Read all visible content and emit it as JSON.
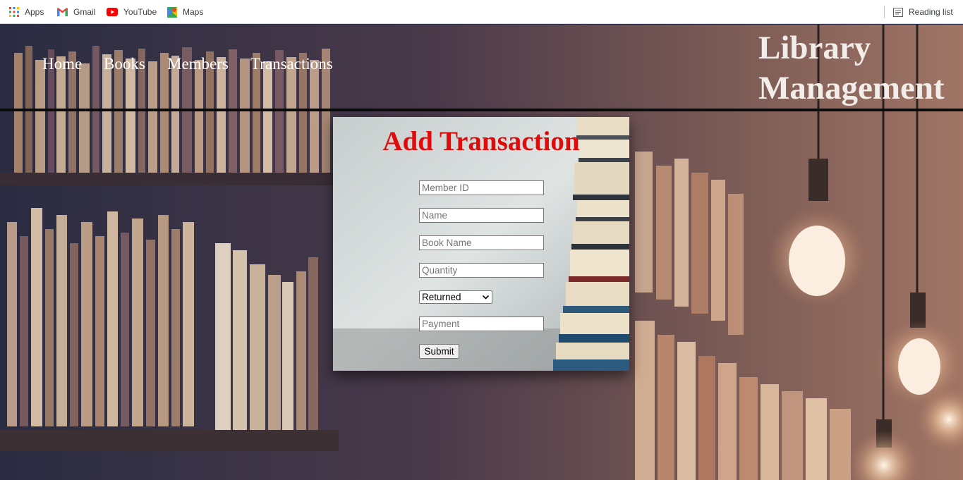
{
  "bookmarks": {
    "items": [
      {
        "label": "Apps",
        "icon": "apps-grid-icon"
      },
      {
        "label": "Gmail",
        "icon": "gmail-icon"
      },
      {
        "label": "YouTube",
        "icon": "youtube-icon"
      },
      {
        "label": "Maps",
        "icon": "maps-icon"
      }
    ],
    "reading_list": {
      "label": "Reading list",
      "icon": "reading-list-icon"
    }
  },
  "nav": {
    "items": [
      {
        "label": "Home"
      },
      {
        "label": "Books"
      },
      {
        "label": "Members"
      },
      {
        "label": "Transactions"
      }
    ],
    "brand": {
      "line1": "Library",
      "line2": "Management"
    }
  },
  "form": {
    "title": "Add Transaction",
    "fields": {
      "member_id": {
        "placeholder": "Member ID",
        "value": ""
      },
      "name": {
        "placeholder": "Name",
        "value": ""
      },
      "book_name": {
        "placeholder": "Book Name",
        "value": ""
      },
      "quantity": {
        "placeholder": "Quantity",
        "value": ""
      },
      "status": {
        "selected": "Returned"
      },
      "payment": {
        "placeholder": "Payment",
        "value": ""
      }
    },
    "submit_label": "Submit",
    "title_color": "#e00b0b"
  }
}
